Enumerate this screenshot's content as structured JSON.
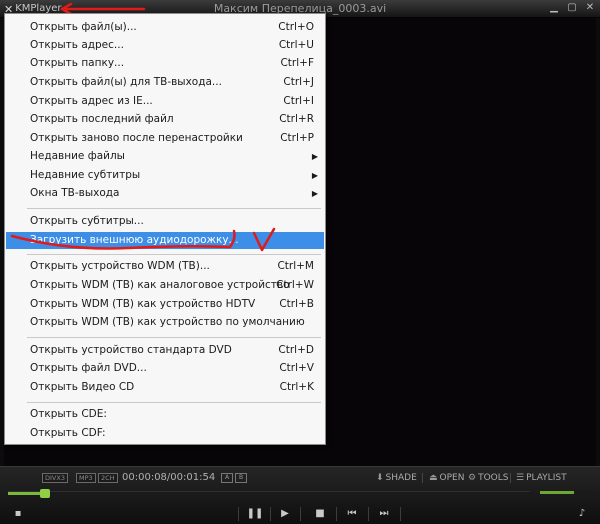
{
  "app": {
    "name": "KMPlayer",
    "title": "Максим Перепелица_0003.avi"
  },
  "menu": {
    "items": [
      {
        "label": "Открыть файл(ы)...",
        "shortcut": "Ctrl+O"
      },
      {
        "label": "Открыть адрес...",
        "shortcut": "Ctrl+U"
      },
      {
        "label": "Открыть папку...",
        "shortcut": "Ctrl+F"
      },
      {
        "label": "Открыть файл(ы) для ТВ-выхода...",
        "shortcut": "Ctrl+J"
      },
      {
        "label": "Открыть адрес из IE...",
        "shortcut": "Ctrl+I"
      },
      {
        "label": "Открыть последний файл",
        "shortcut": "Ctrl+R"
      },
      {
        "label": "Открыть заново после перенастройки",
        "shortcut": "Ctrl+P"
      },
      {
        "label": "Недавние файлы",
        "submenu": true
      },
      {
        "label": "Недавние субтитры",
        "submenu": true
      },
      {
        "label": "Окна ТВ-выхода",
        "submenu": true
      },
      {
        "label": "Открыть субтитры..."
      },
      {
        "label": "Загрузить внешнюю аудиодорожку...",
        "selected": true
      },
      {
        "label": "Открыть устройство WDM (ТВ)...",
        "shortcut": "Ctrl+M"
      },
      {
        "label": "Открыть WDM (ТВ) как аналоговое устройство",
        "shortcut": "Ctrl+W"
      },
      {
        "label": "Открыть WDM (ТВ) как устройство HDTV",
        "shortcut": "Ctrl+B"
      },
      {
        "label": "Открыть WDM (ТВ) как устройство по умолчанию"
      },
      {
        "label": "Открыть устройство стандарта DVD",
        "shortcut": "Ctrl+D"
      },
      {
        "label": "Открыть файл DVD...",
        "shortcut": "Ctrl+V"
      },
      {
        "label": "Открыть Видео CD",
        "shortcut": "Ctrl+K"
      },
      {
        "label": "Открыть CDE:"
      },
      {
        "label": "Открыть CDF:"
      }
    ]
  },
  "controls": {
    "tags": [
      "DIVX3",
      "MP3",
      "2CH"
    ],
    "time": "00:00:08/00:01:54",
    "shade": "SHADE",
    "open": "OPEN",
    "tools": "TOOLS",
    "playlist": "PLAYLIST",
    "progress_fraction": 0.07,
    "volume_fraction": 0.6
  },
  "colors": {
    "menu_highlight": "#3d8ee6",
    "annotation_red": "#e11a1a",
    "seek_green": "#7ab93a"
  }
}
